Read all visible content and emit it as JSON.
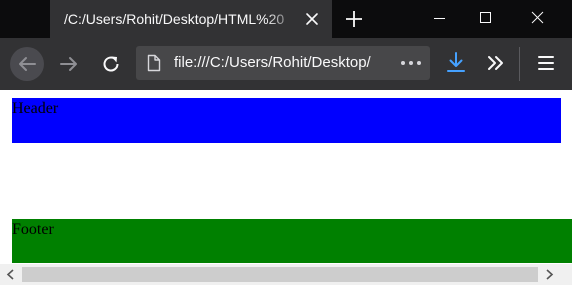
{
  "browser": {
    "tab": {
      "title": "/C:/Users/Rohit/Desktop/HTML%20"
    },
    "address_bar": {
      "url": "file:///C:/Users/Rohit/Desktop/"
    }
  },
  "page": {
    "header_text": "Header",
    "footer_text": "Footer",
    "colors": {
      "header": "#0000ff",
      "footer": "#008000",
      "background": "#ffffff"
    }
  },
  "icons": [
    "close-icon",
    "plus-icon",
    "minimize-icon",
    "maximize-icon",
    "close-window-icon",
    "back-arrow-icon",
    "forward-arrow-icon",
    "reload-icon",
    "page-icon",
    "more-actions-icon",
    "download-icon",
    "chevron-double-right-icon",
    "hamburger-menu-icon",
    "scroll-left-arrow-icon",
    "scroll-right-arrow-icon"
  ]
}
